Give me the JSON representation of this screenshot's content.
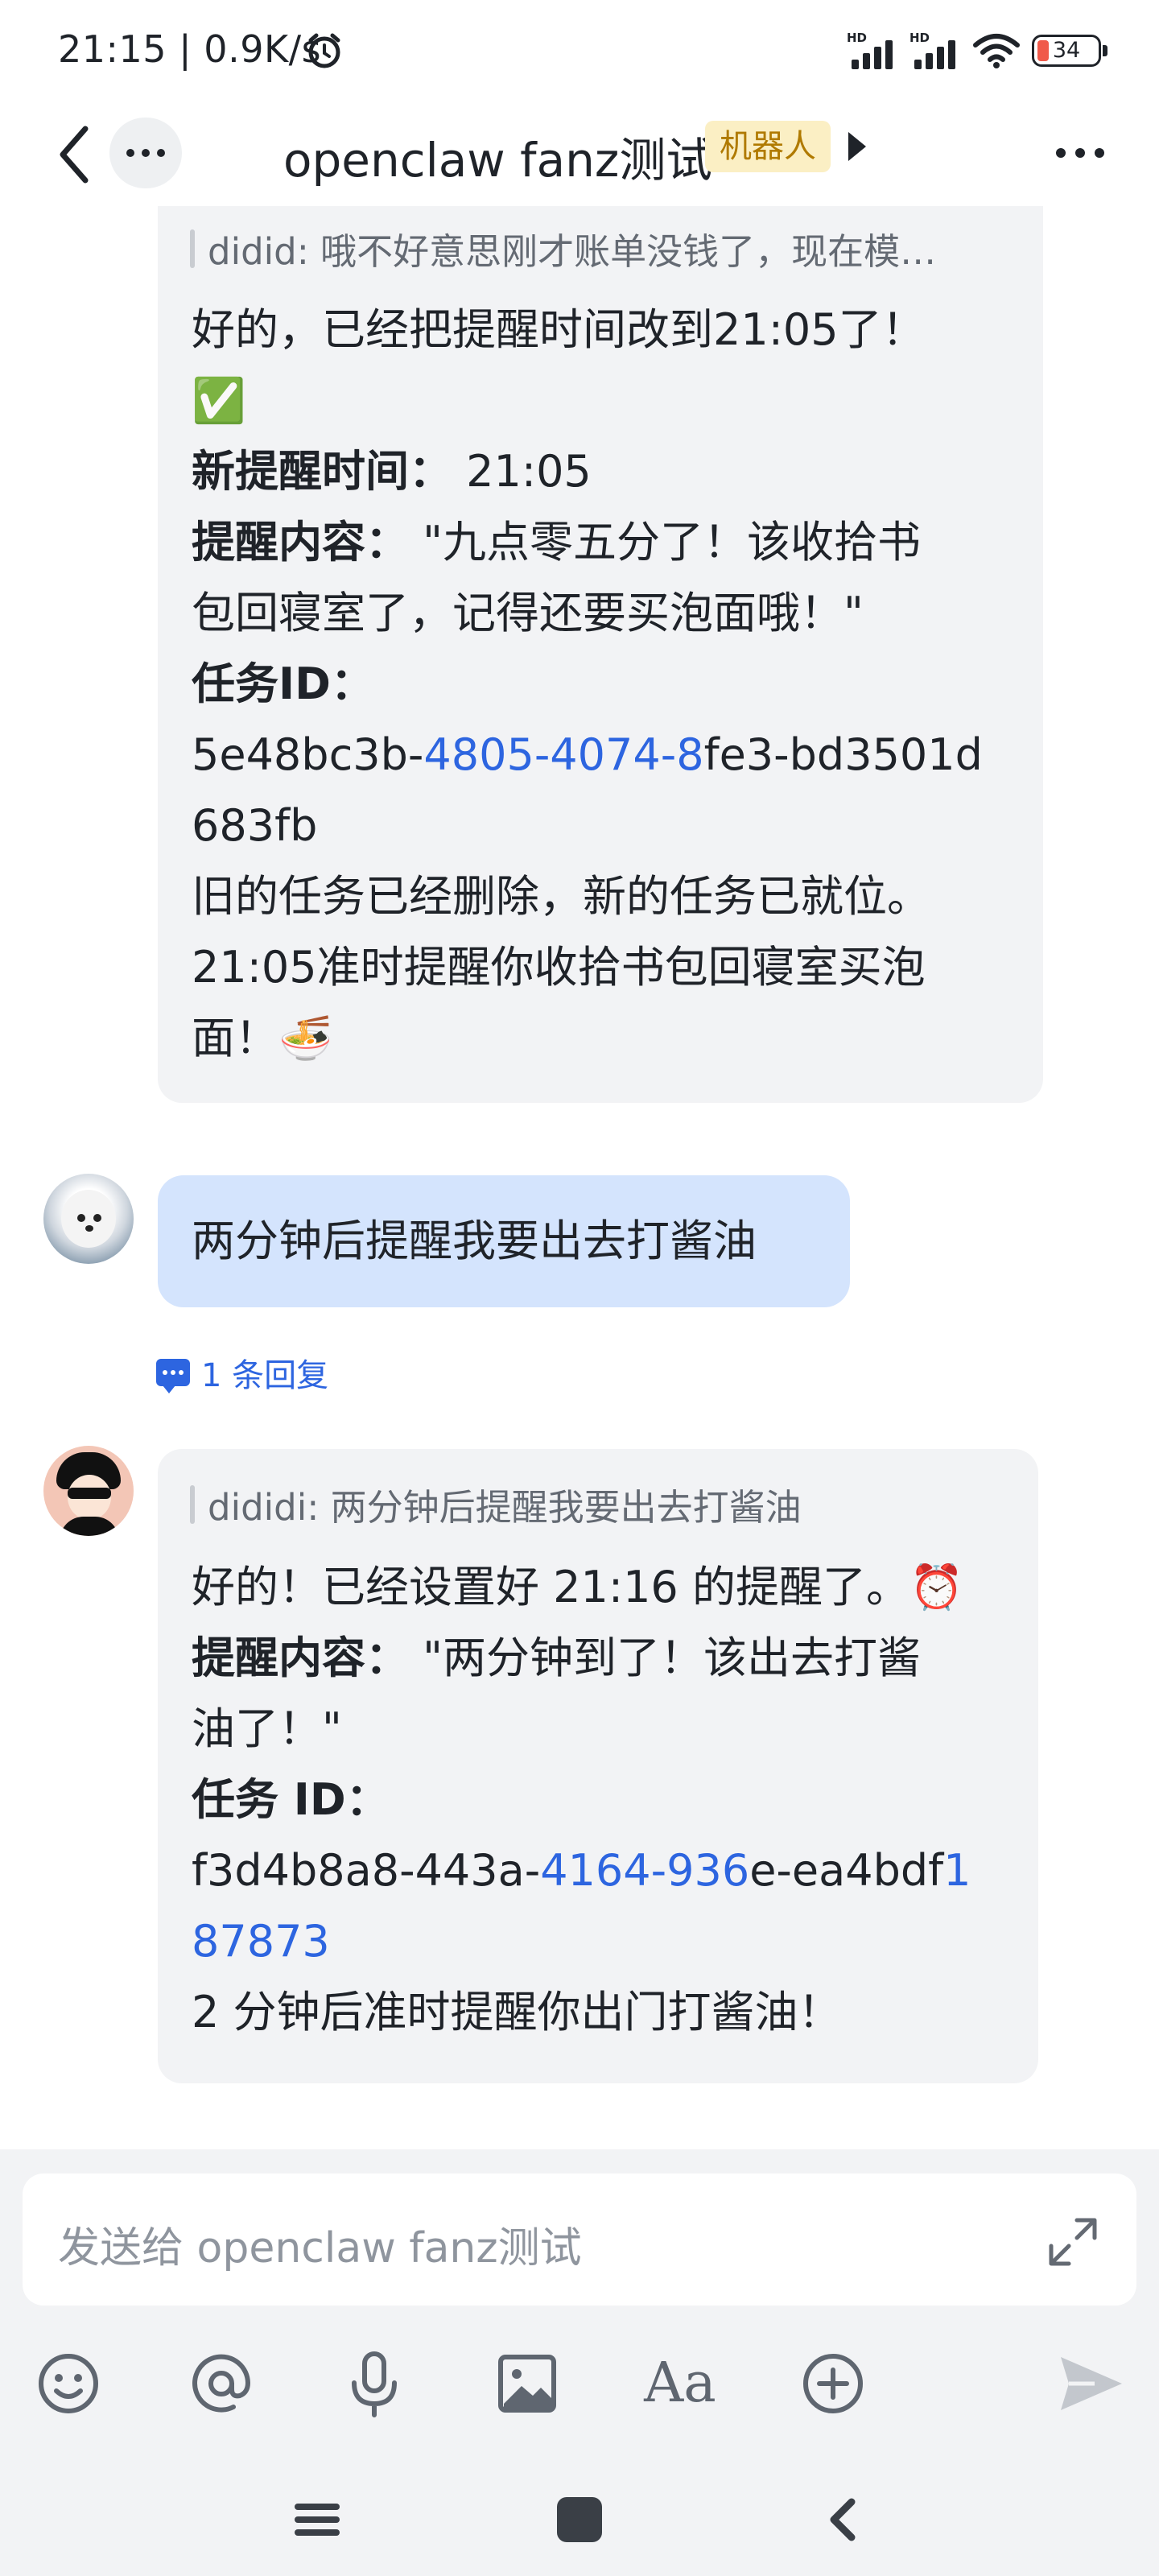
{
  "status_bar": {
    "time": "21:15 | 0.9K/s",
    "signal_label": "HD",
    "battery_level": "34"
  },
  "header": {
    "title": "openclaw fanz测试",
    "badge": "机器人"
  },
  "messages": {
    "bot_reply_1": {
      "quote": "didid: 哦不好意思刚才账单没钱了，现在模…",
      "line1": "好的，已经把提醒时间改到21:05了！",
      "line2": "✅",
      "time_label": "新提醒时间：",
      "time_value": " 21:05",
      "content_label": "提醒内容：",
      "content_value_a": " \"九点零五分了！该收拾书",
      "content_value_b": "包回寝室了，记得还要买泡面哦！\"",
      "task_label": "任务ID：",
      "task_id_a": "5e48bc3b-",
      "task_id_link": "4805-4074-8",
      "task_id_b": "fe3-bd3501d",
      "task_id_c": "683fb",
      "line_old": "旧的任务已经删除，新的任务已就位。",
      "line_final_a": "21:05准时提醒你收拾书包回寝室买泡",
      "line_final_b": "面！🍜"
    },
    "user_msg": {
      "text": "两分钟后提醒我要出去打酱油",
      "reply_count": "1 条回复"
    },
    "bot_reply_2": {
      "quote": "dididi: 两分钟后提醒我要出去打酱油",
      "line1": "好的！已经设置好 21:16 的提醒了。⏰",
      "content_label": "提醒内容：",
      "content_value_a": " \"两分钟到了！该出去打酱",
      "content_value_b": "油了！\"",
      "task_label": "任务 ID：",
      "task_id_a": "f3d4b8a8-443a-",
      "task_id_link": "4164-936",
      "task_id_b": "e-ea4bdf",
      "task_id_link2": "1",
      "task_id_link3": "87873",
      "line_final": "2 分钟后准时提醒你出门打酱油！"
    }
  },
  "composer": {
    "placeholder": "发送给 openclaw fanz测试",
    "tools": [
      "emoji-icon",
      "at-icon",
      "microphone-icon",
      "image-icon",
      "font-icon",
      "add-icon",
      "send-icon"
    ],
    "font_tool_label": "Aa"
  },
  "colors": {
    "link": "#2d65e0",
    "user_bubble": "#d4e4fd",
    "bot_bubble": "#f2f3f5",
    "badge_bg": "#fbefc4"
  }
}
